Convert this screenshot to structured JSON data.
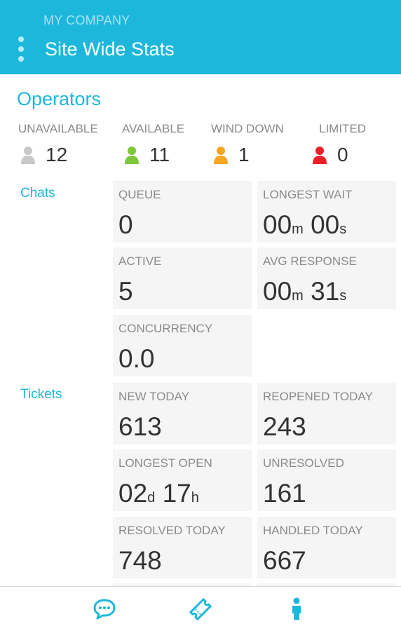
{
  "header": {
    "company": "MY COMPANY",
    "title": "Site Wide Stats"
  },
  "operators": {
    "title": "Operators",
    "statuses": [
      {
        "label": "UNAVAILABLE",
        "count": "12",
        "color": "#c8c8c8"
      },
      {
        "label": "AVAILABLE",
        "count": "11",
        "color": "#7dc83a"
      },
      {
        "label": "WIND DOWN",
        "count": "1",
        "color": "#f5a623"
      },
      {
        "label": "LIMITED",
        "count": "0",
        "color": "#e8202a"
      }
    ]
  },
  "chats": {
    "label": "Chats",
    "queue": {
      "label": "QUEUE",
      "value": "0"
    },
    "longest_wait": {
      "label": "LONGEST WAIT",
      "v1": "00",
      "u1": "m",
      "v2": "00",
      "u2": "s"
    },
    "active": {
      "label": "ACTIVE",
      "value": "5"
    },
    "avg_response": {
      "label": "AVG RESPONSE",
      "v1": "00",
      "u1": "m",
      "v2": "31",
      "u2": "s"
    },
    "concurrency": {
      "label": "CONCURRENCY",
      "value": "0.0"
    }
  },
  "tickets": {
    "label": "Tickets",
    "new_today": {
      "label": "NEW TODAY",
      "value": "613"
    },
    "reopened_today": {
      "label": "REOPENED TODAY",
      "value": "243"
    },
    "longest_open": {
      "label": "LONGEST OPEN",
      "v1": "02",
      "u1": "d",
      "v2": "17",
      "u2": "h"
    },
    "unresolved": {
      "label": "UNRESOLVED",
      "value": "161"
    },
    "resolved_today": {
      "label": "RESOLVED TODAY",
      "value": "748"
    },
    "handled_today": {
      "label": "HANDLED TODAY",
      "value": "667"
    }
  },
  "nav": {
    "items": [
      {
        "icon": "chat-bubble-icon"
      },
      {
        "icon": "ticket-icon"
      },
      {
        "icon": "person-icon"
      }
    ],
    "accent": "#1eb7dc"
  }
}
